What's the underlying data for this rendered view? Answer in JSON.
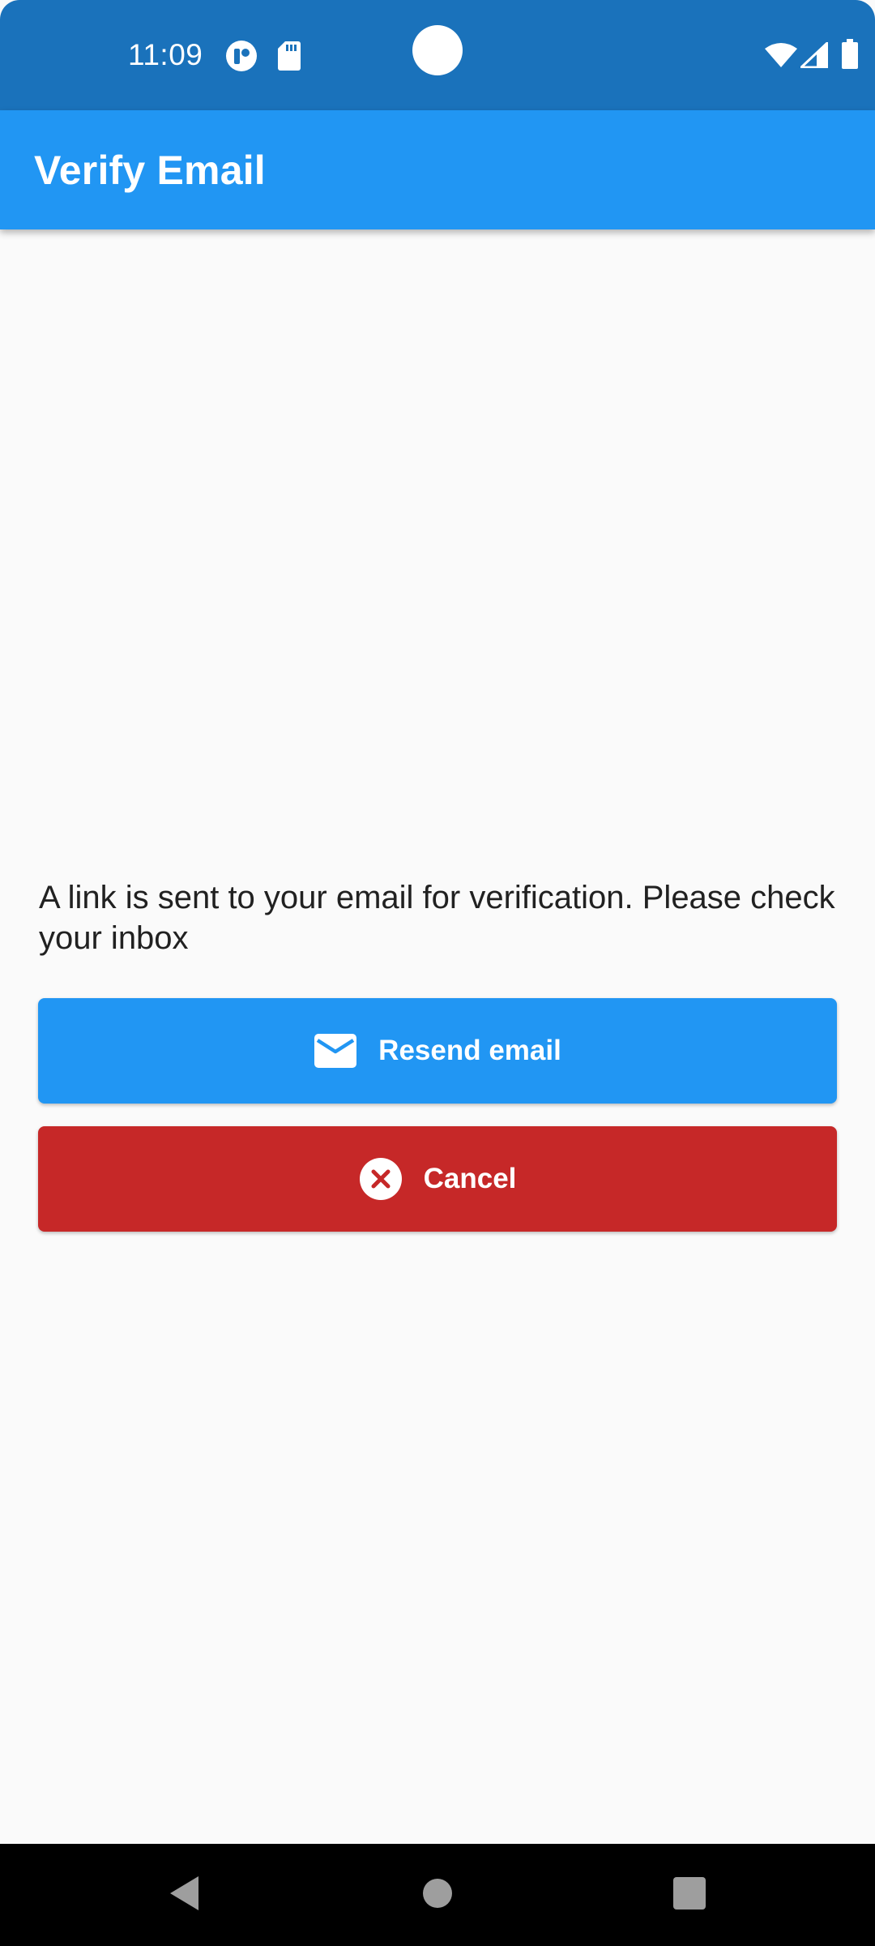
{
  "status_bar": {
    "time": "11:09",
    "icons": [
      "notification-icon",
      "sd-card-icon",
      "wifi-icon",
      "signal-icon",
      "battery-icon"
    ]
  },
  "app_bar": {
    "title": "Verify Email"
  },
  "main": {
    "message": "A link is sent to your email for verification. Please check your inbox",
    "resend_button": {
      "label": "Resend email",
      "icon": "email-icon"
    },
    "cancel_button": {
      "label": "Cancel",
      "icon": "cancel-circle-icon"
    }
  },
  "nav_bar": {
    "items": [
      "back-icon",
      "home-icon",
      "recents-icon"
    ]
  },
  "colors": {
    "status_bar": "#1a72bb",
    "primary": "#2196f3",
    "danger": "#c62828",
    "background": "#fafafa",
    "text": "#212121"
  }
}
